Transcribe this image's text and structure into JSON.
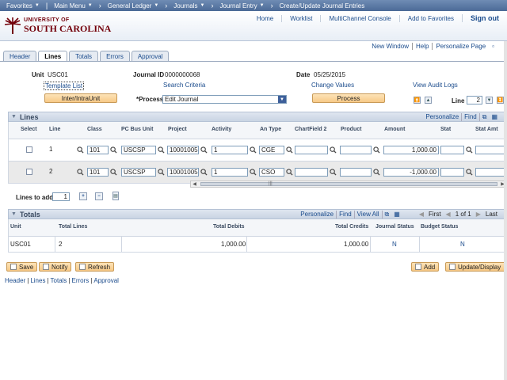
{
  "nav": {
    "items": [
      "Favorites",
      "Main Menu",
      "General Ledger",
      "Journals",
      "Journal Entry",
      "Create/Update Journal Entries"
    ]
  },
  "header": {
    "logo_line1": "UNIVERSITY OF",
    "logo_line2": "SOUTH CAROLINA",
    "links": [
      "Home",
      "Worklist",
      "MultiChannel Console",
      "Add to Favorites"
    ],
    "signout": "Sign out"
  },
  "pagebar": {
    "links": [
      "New Window",
      "Help",
      "Personalize Page"
    ]
  },
  "tabs": [
    "Header",
    "Lines",
    "Totals",
    "Errors",
    "Approval"
  ],
  "active_tab": "Lines",
  "form": {
    "unit_label": "Unit",
    "unit_value": "USC01",
    "journal_id_label": "Journal ID",
    "journal_id_value": "0000000068",
    "date_label": "Date",
    "date_value": "05/25/2015",
    "template_list": "Template List",
    "search_criteria": "Search Criteria",
    "change_values": "Change Values",
    "view_audit_logs": "View Audit Logs",
    "inter_intra_button": "Inter/IntraUnit",
    "process_label": "*Process",
    "process_value": "Edit Journal",
    "process_button": "Process",
    "line_label": "Line",
    "line_value": "2"
  },
  "lines_grid": {
    "title": "Lines",
    "tools": [
      "Personalize",
      "Find"
    ],
    "columns": [
      "Select",
      "Line",
      "Class",
      "PC Bus Unit",
      "Project",
      "Activity",
      "An Type",
      "ChartField 2",
      "Product",
      "Amount",
      "Stat",
      "Stat Amt"
    ],
    "rows": [
      {
        "line": "1",
        "class": "101",
        "pc_bus_unit": "USCSP",
        "project": "10001005",
        "activity": "1",
        "an_type": "CGE",
        "chartfield2": "",
        "product": "",
        "amount": "1,000.00",
        "stat": "",
        "stat_amt": ""
      },
      {
        "line": "2",
        "class": "101",
        "pc_bus_unit": "USCSP",
        "project": "10001005",
        "activity": "1",
        "an_type": "CSO",
        "chartfield2": "",
        "product": "",
        "amount": "-1,000.00",
        "stat": "",
        "stat_amt": ""
      }
    ],
    "lines_to_add_label": "Lines to add",
    "lines_to_add_value": "1"
  },
  "totals_grid": {
    "title": "Totals",
    "tools": [
      "Personalize",
      "Find",
      "View All"
    ],
    "nav_first": "First",
    "nav_range": "1 of 1",
    "nav_last": "Last",
    "columns": [
      "Unit",
      "Total Lines",
      "Total Debits",
      "Total Credits",
      "Journal Status",
      "Budget Status"
    ],
    "rows": [
      {
        "unit": "USC01",
        "total_lines": "2",
        "total_debits": "1,000.00",
        "total_credits": "1,000.00",
        "journal_status": "N",
        "budget_status": "N"
      }
    ]
  },
  "buttons": {
    "save": "Save",
    "notify": "Notify",
    "refresh": "Refresh",
    "add": "Add",
    "update_display": "Update/Display"
  },
  "footer_links": [
    "Header",
    "Lines",
    "Totals",
    "Errors",
    "Approval"
  ],
  "colors": {
    "nav_bar": "#4b6a97",
    "brand": "#73000a",
    "link": "#1a4b8c",
    "button": "#f7c987"
  }
}
